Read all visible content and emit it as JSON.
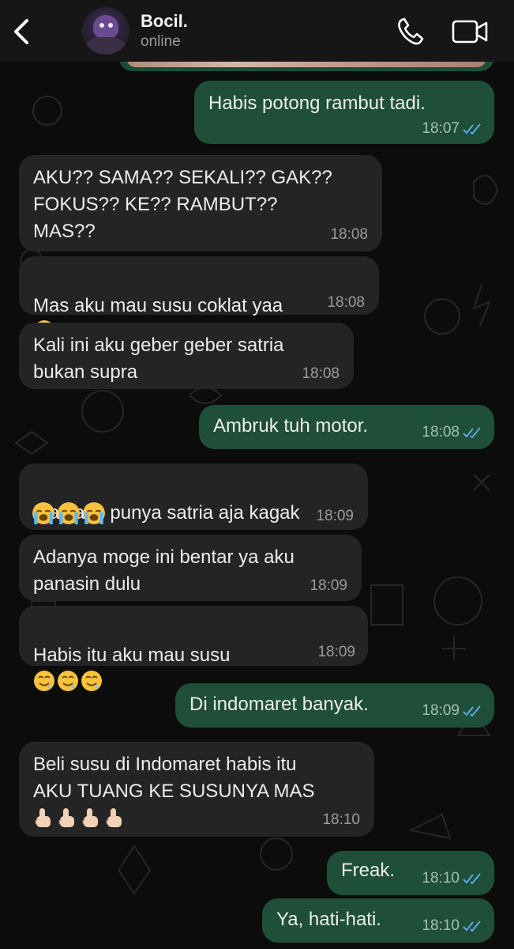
{
  "header": {
    "back_icon": "chevron-left-icon",
    "contact_name": "Bocil.",
    "contact_status": "online",
    "call_icon": "phone-icon",
    "video_icon": "video-camera-icon"
  },
  "messages": [
    {
      "dir": "out",
      "text": "Habis potong rambut tadi.",
      "time": "18:07",
      "status": "read"
    },
    {
      "dir": "in",
      "text": "AKU?? SAMA?? SEKALI?? GAK??\nFOKUS?? KE?? RAMBUT??\nMAS??",
      "time": "18:08"
    },
    {
      "dir": "in",
      "text": "Mas aku mau susu coklat yaa",
      "emoji": "drooling-face",
      "time": "18:08"
    },
    {
      "dir": "in",
      "text": "Kali ini aku geber geber satria\nbukan supra",
      "time": "18:08"
    },
    {
      "dir": "out",
      "text": "Ambruk tuh motor.",
      "time": "18:08",
      "status": "read"
    },
    {
      "dir": "in",
      "text": "Mas aku punya satria aja kagak",
      "emoji_line": "loudly-crying-face x3",
      "time": "18:09"
    },
    {
      "dir": "in",
      "text": "Adanya moge ini bentar ya aku\npanasin dulu",
      "time": "18:09"
    },
    {
      "dir": "in",
      "text": "Habis itu aku mau susu",
      "emoji": "drooling-face x3",
      "time": "18:09"
    },
    {
      "dir": "out",
      "text": "Di indomaret banyak.",
      "time": "18:09",
      "status": "read"
    },
    {
      "dir": "in",
      "text": "Beli susu di Indomaret habis itu\nAKU TUANG KE SUSUNYA MAS",
      "emoji_line": "index-pointing-up x4",
      "time": "18:10"
    },
    {
      "dir": "out",
      "text": "Freak.",
      "time": "18:10",
      "status": "read"
    },
    {
      "dir": "out",
      "text": "Ya, hati-hati.",
      "time": "18:10",
      "status": "read"
    }
  ],
  "colors": {
    "background": "#0c0c0c",
    "incoming_bubble": "#242424",
    "outgoing_bubble": "#1f4f38",
    "read_ticks": "#5da8e8"
  }
}
